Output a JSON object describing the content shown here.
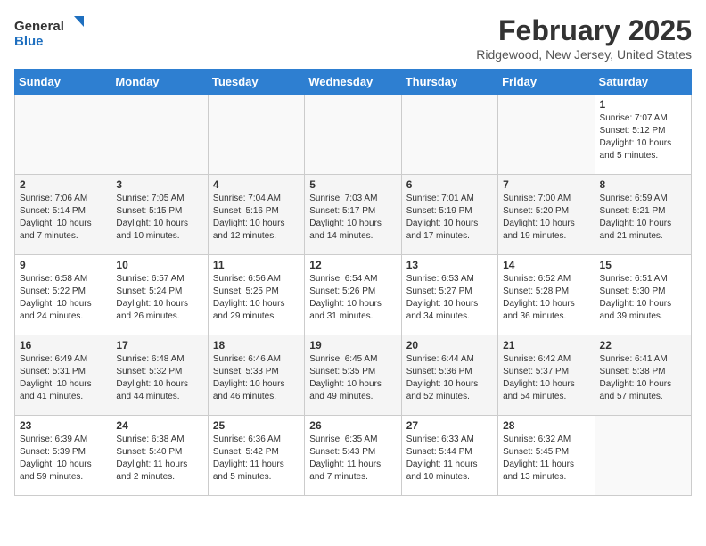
{
  "logo": {
    "line1": "General",
    "line2": "Blue"
  },
  "title": "February 2025",
  "subtitle": "Ridgewood, New Jersey, United States",
  "days_of_week": [
    "Sunday",
    "Monday",
    "Tuesday",
    "Wednesday",
    "Thursday",
    "Friday",
    "Saturday"
  ],
  "weeks": [
    [
      {
        "day": "",
        "info": ""
      },
      {
        "day": "",
        "info": ""
      },
      {
        "day": "",
        "info": ""
      },
      {
        "day": "",
        "info": ""
      },
      {
        "day": "",
        "info": ""
      },
      {
        "day": "",
        "info": ""
      },
      {
        "day": "1",
        "info": "Sunrise: 7:07 AM\nSunset: 5:12 PM\nDaylight: 10 hours\nand 5 minutes."
      }
    ],
    [
      {
        "day": "2",
        "info": "Sunrise: 7:06 AM\nSunset: 5:14 PM\nDaylight: 10 hours\nand 7 minutes."
      },
      {
        "day": "3",
        "info": "Sunrise: 7:05 AM\nSunset: 5:15 PM\nDaylight: 10 hours\nand 10 minutes."
      },
      {
        "day": "4",
        "info": "Sunrise: 7:04 AM\nSunset: 5:16 PM\nDaylight: 10 hours\nand 12 minutes."
      },
      {
        "day": "5",
        "info": "Sunrise: 7:03 AM\nSunset: 5:17 PM\nDaylight: 10 hours\nand 14 minutes."
      },
      {
        "day": "6",
        "info": "Sunrise: 7:01 AM\nSunset: 5:19 PM\nDaylight: 10 hours\nand 17 minutes."
      },
      {
        "day": "7",
        "info": "Sunrise: 7:00 AM\nSunset: 5:20 PM\nDaylight: 10 hours\nand 19 minutes."
      },
      {
        "day": "8",
        "info": "Sunrise: 6:59 AM\nSunset: 5:21 PM\nDaylight: 10 hours\nand 21 minutes."
      }
    ],
    [
      {
        "day": "9",
        "info": "Sunrise: 6:58 AM\nSunset: 5:22 PM\nDaylight: 10 hours\nand 24 minutes."
      },
      {
        "day": "10",
        "info": "Sunrise: 6:57 AM\nSunset: 5:24 PM\nDaylight: 10 hours\nand 26 minutes."
      },
      {
        "day": "11",
        "info": "Sunrise: 6:56 AM\nSunset: 5:25 PM\nDaylight: 10 hours\nand 29 minutes."
      },
      {
        "day": "12",
        "info": "Sunrise: 6:54 AM\nSunset: 5:26 PM\nDaylight: 10 hours\nand 31 minutes."
      },
      {
        "day": "13",
        "info": "Sunrise: 6:53 AM\nSunset: 5:27 PM\nDaylight: 10 hours\nand 34 minutes."
      },
      {
        "day": "14",
        "info": "Sunrise: 6:52 AM\nSunset: 5:28 PM\nDaylight: 10 hours\nand 36 minutes."
      },
      {
        "day": "15",
        "info": "Sunrise: 6:51 AM\nSunset: 5:30 PM\nDaylight: 10 hours\nand 39 minutes."
      }
    ],
    [
      {
        "day": "16",
        "info": "Sunrise: 6:49 AM\nSunset: 5:31 PM\nDaylight: 10 hours\nand 41 minutes."
      },
      {
        "day": "17",
        "info": "Sunrise: 6:48 AM\nSunset: 5:32 PM\nDaylight: 10 hours\nand 44 minutes."
      },
      {
        "day": "18",
        "info": "Sunrise: 6:46 AM\nSunset: 5:33 PM\nDaylight: 10 hours\nand 46 minutes."
      },
      {
        "day": "19",
        "info": "Sunrise: 6:45 AM\nSunset: 5:35 PM\nDaylight: 10 hours\nand 49 minutes."
      },
      {
        "day": "20",
        "info": "Sunrise: 6:44 AM\nSunset: 5:36 PM\nDaylight: 10 hours\nand 52 minutes."
      },
      {
        "day": "21",
        "info": "Sunrise: 6:42 AM\nSunset: 5:37 PM\nDaylight: 10 hours\nand 54 minutes."
      },
      {
        "day": "22",
        "info": "Sunrise: 6:41 AM\nSunset: 5:38 PM\nDaylight: 10 hours\nand 57 minutes."
      }
    ],
    [
      {
        "day": "23",
        "info": "Sunrise: 6:39 AM\nSunset: 5:39 PM\nDaylight: 10 hours\nand 59 minutes."
      },
      {
        "day": "24",
        "info": "Sunrise: 6:38 AM\nSunset: 5:40 PM\nDaylight: 11 hours\nand 2 minutes."
      },
      {
        "day": "25",
        "info": "Sunrise: 6:36 AM\nSunset: 5:42 PM\nDaylight: 11 hours\nand 5 minutes."
      },
      {
        "day": "26",
        "info": "Sunrise: 6:35 AM\nSunset: 5:43 PM\nDaylight: 11 hours\nand 7 minutes."
      },
      {
        "day": "27",
        "info": "Sunrise: 6:33 AM\nSunset: 5:44 PM\nDaylight: 11 hours\nand 10 minutes."
      },
      {
        "day": "28",
        "info": "Sunrise: 6:32 AM\nSunset: 5:45 PM\nDaylight: 11 hours\nand 13 minutes."
      },
      {
        "day": "",
        "info": ""
      }
    ]
  ]
}
